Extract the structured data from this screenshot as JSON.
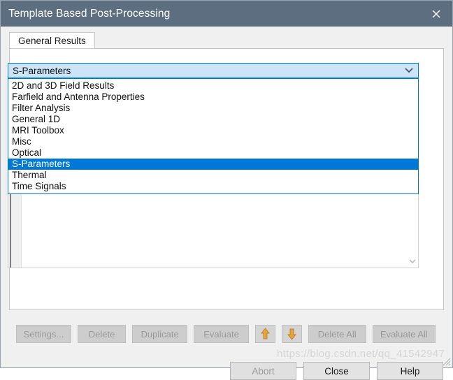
{
  "window": {
    "title": "Template Based Post-Processing",
    "close_icon": "close-icon"
  },
  "tabs": [
    {
      "label": "General Results",
      "active": true
    }
  ],
  "combo": {
    "selected": "S-Parameters",
    "arrow_icon": "chevron-down-icon",
    "options": [
      "2D and 3D Field Results",
      "Farfield and Antenna Properties",
      "Filter Analysis",
      "General 1D",
      "MRI Toolbox",
      "Misc",
      "Optical",
      "S-Parameters",
      "Thermal",
      "Time Signals"
    ],
    "selected_index": 7
  },
  "list_panel": {
    "scroll_down_icon": "chevron-down-icon",
    "items": []
  },
  "toolbar": {
    "buttons": [
      {
        "label": "Settings...",
        "name": "settings-button",
        "enabled": false
      },
      {
        "label": "Delete",
        "name": "delete-button",
        "enabled": false
      },
      {
        "label": "Duplicate",
        "name": "duplicate-button",
        "enabled": false
      },
      {
        "label": "Evaluate",
        "name": "evaluate-button",
        "enabled": false
      },
      {
        "label": "",
        "name": "move-up-button",
        "icon": "arrow-up-icon",
        "enabled": true
      },
      {
        "label": "",
        "name": "move-down-button",
        "icon": "arrow-down-icon",
        "enabled": true
      },
      {
        "label": "Delete All",
        "name": "delete-all-button",
        "enabled": false
      },
      {
        "label": "Evaluate All",
        "name": "evaluate-all-button",
        "enabled": false
      }
    ]
  },
  "bottom": {
    "abort": "Abort",
    "close": "Close",
    "help": "Help"
  },
  "watermark": "https://blog.csdn.net/qq_41542947",
  "colors": {
    "titlebar": "#5e6e81",
    "accent_blue": "#0078d7",
    "combo_fill": "#cce4f7",
    "dialog_bg": "#f0f0f0",
    "arrow_orange": "#e8a33d"
  }
}
